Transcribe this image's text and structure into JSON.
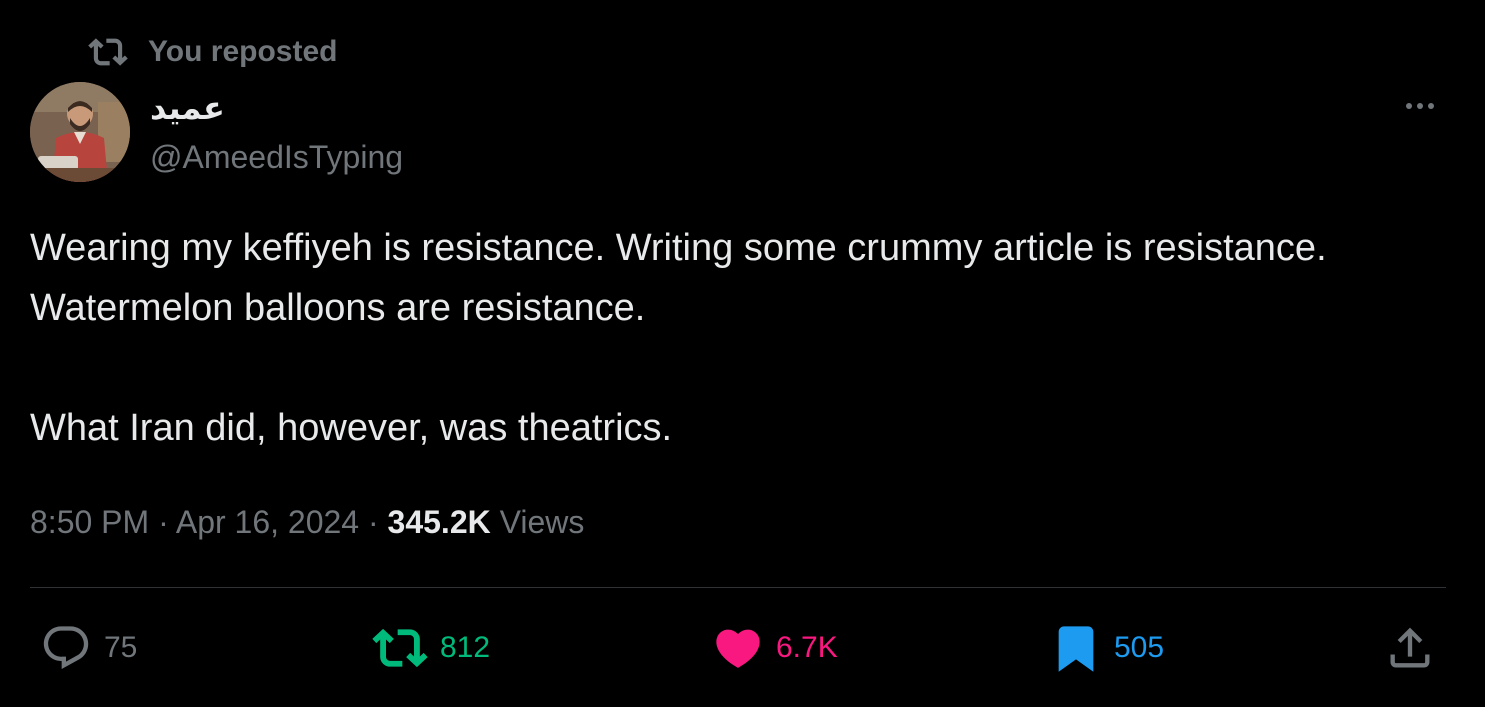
{
  "repost_banner": {
    "icon": "repost-icon",
    "label": "You reposted"
  },
  "author": {
    "avatar": "avatar",
    "display_name": "عميد",
    "handle": "@AmeedIsTyping"
  },
  "more_icon": "more-icon",
  "tweet": {
    "paragraphs": [
      "Wearing my keffiyeh is resistance. Writing some crummy article is resistance. Watermelon balloons are resistance.",
      "What Iran did, however, was theatrics."
    ]
  },
  "meta": {
    "time": "8:50 PM",
    "separator": "·",
    "date": "Apr 16, 2024",
    "views_count": "345.2K",
    "views_label": "Views"
  },
  "actions": {
    "reply": {
      "icon": "reply-icon",
      "count": "75",
      "color": "#71767b"
    },
    "repost": {
      "icon": "repost-icon",
      "count": "812",
      "color": "#00ba7c"
    },
    "like": {
      "icon": "heart-icon",
      "count": "6.7K",
      "color": "#f91880"
    },
    "bookmark": {
      "icon": "bookmark-icon",
      "count": "505",
      "color": "#1d9bf0"
    },
    "share": {
      "icon": "share-icon"
    }
  },
  "colors": {
    "background": "#000000",
    "text_primary": "#e7e9ea",
    "text_secondary": "#71767b",
    "divider": "#2f3336"
  }
}
